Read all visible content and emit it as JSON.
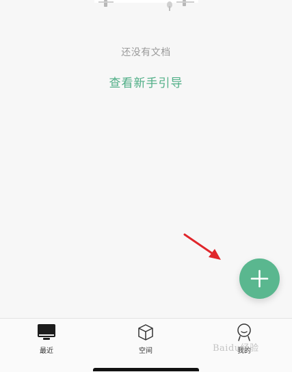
{
  "empty_state": {
    "message": "还没有文档",
    "guide_link": "查看新手引导"
  },
  "fab": {
    "icon": "plus-icon",
    "color": "#5ab78f"
  },
  "annotation": {
    "icon": "red-arrow-icon",
    "color": "#e0262b"
  },
  "tabs": [
    {
      "label": "最近",
      "icon": "monitor-icon",
      "selected": true
    },
    {
      "label": "空间",
      "icon": "cube-icon",
      "selected": false
    },
    {
      "label": "我的",
      "icon": "user-icon",
      "selected": false
    }
  ],
  "watermark": "Baidu经验",
  "colors": {
    "accent": "#4fae86",
    "background": "#f7f7f7",
    "muted_text": "#9a9a9a"
  }
}
